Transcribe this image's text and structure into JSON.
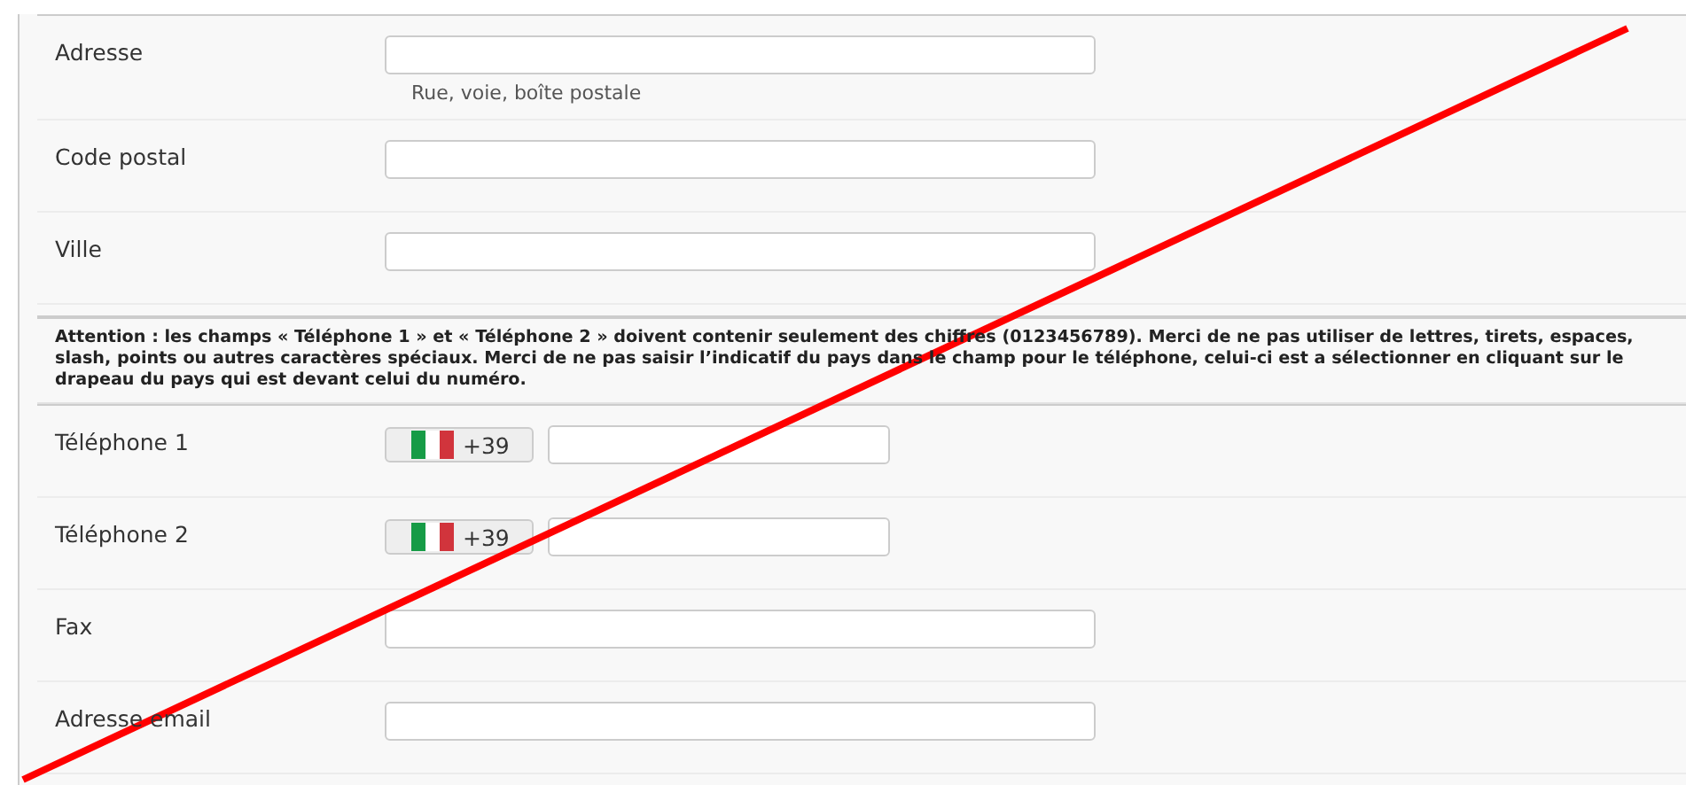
{
  "address_rows": [
    {
      "kind": "text",
      "label": "Adresse",
      "hint": "Rue, voie, boîte postale"
    },
    {
      "kind": "text",
      "label": "Code postal"
    },
    {
      "kind": "text",
      "label": "Ville"
    }
  ],
  "notice": "Attention : les champs « Téléphone 1 » et « Téléphone 2 » doivent contenir seulement des chiffres (0123456789). Merci de ne pas utiliser de lettres, tirets, espaces, slash, points ou autres caractères spéciaux. Merci de ne pas saisir l’indicatif du pays dans le champ pour le téléphone, celui-ci est a sélectionner en cliquant sur le drapeau du pays qui est devant celui du numéro.",
  "contact_rows": [
    {
      "kind": "phone",
      "label": "Téléphone 1",
      "dial_code": "+39"
    },
    {
      "kind": "phone",
      "label": "Téléphone 2",
      "dial_code": "+39"
    },
    {
      "kind": "text",
      "label": "Fax"
    },
    {
      "kind": "text",
      "label": "Adresse email"
    }
  ]
}
